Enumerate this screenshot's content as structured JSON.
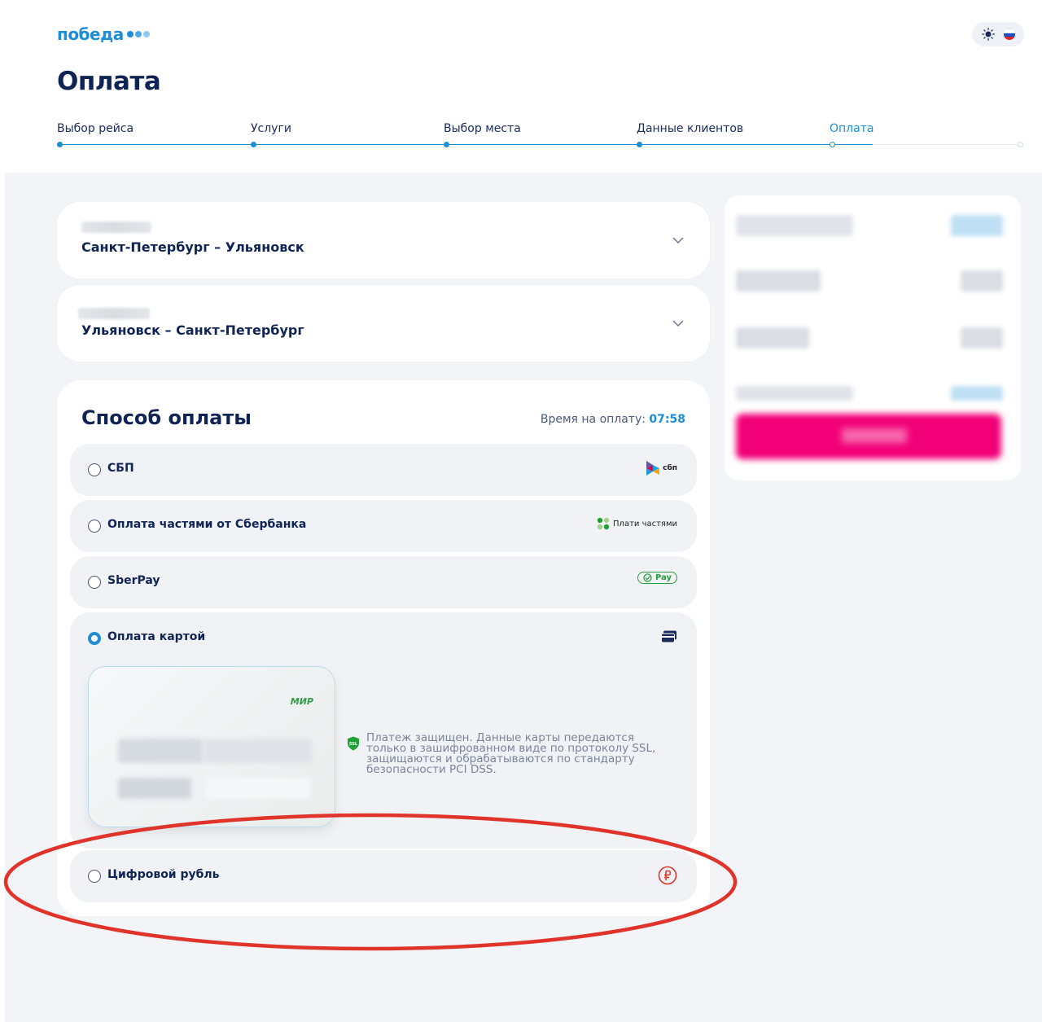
{
  "brand": {
    "logo_text": "победа",
    "colors": {
      "primary": "#1c8ed6",
      "accent": "#f20078",
      "dark": "#0f2455"
    }
  },
  "header": {
    "theme_toggle_icon": "sun-icon",
    "language_icon": "russian-flag-icon"
  },
  "page": {
    "title": "Оплата"
  },
  "steps": [
    {
      "label": "Выбор рейса",
      "state": "done"
    },
    {
      "label": "Услуги",
      "state": "done"
    },
    {
      "label": "Выбор места",
      "state": "done"
    },
    {
      "label": "Данные клиентов",
      "state": "done"
    },
    {
      "label": "Оплата",
      "state": "current"
    }
  ],
  "routes": [
    {
      "title": "Санкт-Петербург – Ульяновск"
    },
    {
      "title": "Ульяновск – Санкт-Петербург"
    }
  ],
  "payment": {
    "title": "Способ оплаты",
    "timer_label": "Время на оплату:",
    "timer_value": "07:58",
    "options": [
      {
        "label": "СБП",
        "icon": "sbp-logo-icon",
        "icon_text": "сбп",
        "selected": false
      },
      {
        "label": "Оплата частями от Сбербанка",
        "icon": "installments-icon",
        "icon_text": "Плати частями",
        "selected": false
      },
      {
        "label": "SberPay",
        "icon": "sberpay-icon",
        "icon_text": "Pay",
        "selected": false
      },
      {
        "label": "Оплата картой",
        "icon": "card-icon",
        "selected": true
      },
      {
        "label": "Цифровой рубль",
        "icon": "digital-ruble-icon",
        "selected": false
      }
    ],
    "card": {
      "brand_mark": "МИР"
    },
    "security_note": {
      "badge": "SSL",
      "text": "Платеж защищен. Данные карты передаются только в зашифрованном виде по протоколу SSL, защищаются и обрабатываются по стандарту безопасности PCI DSS."
    }
  },
  "annotation": {
    "highlight_color": "#e0342a"
  }
}
